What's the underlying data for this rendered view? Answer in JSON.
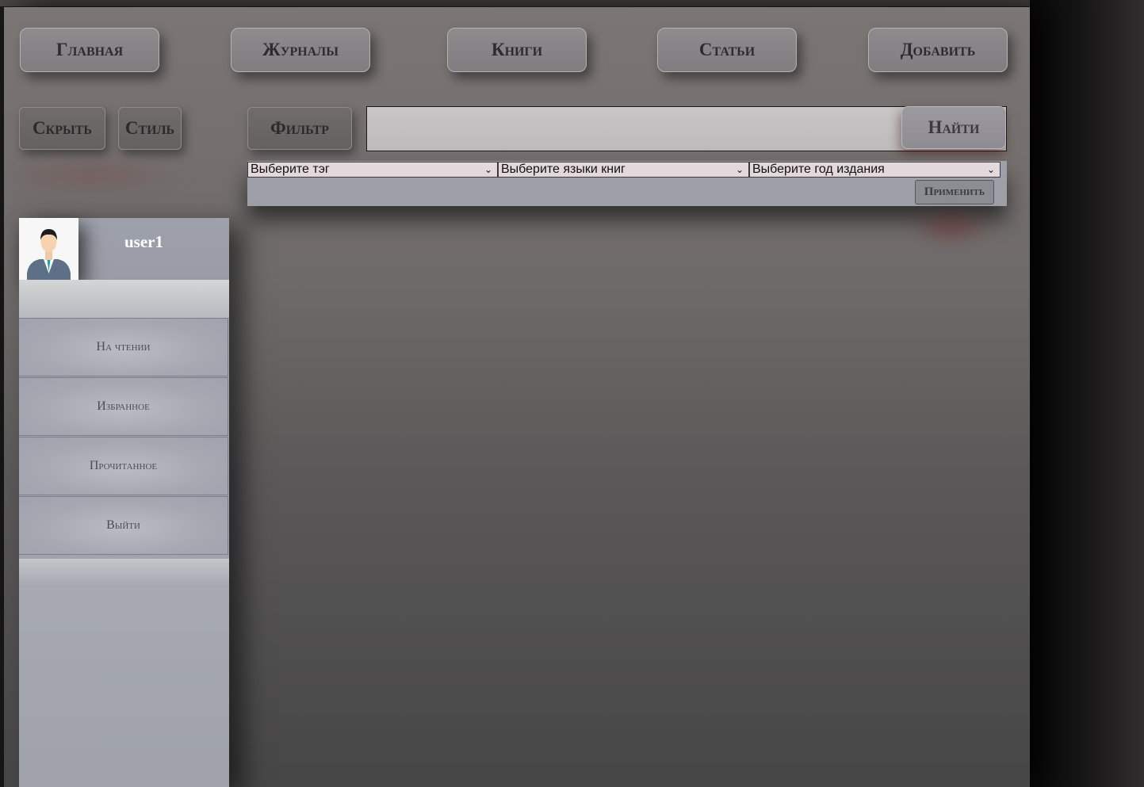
{
  "nav": {
    "items": [
      {
        "label": "Главная"
      },
      {
        "label": "Журналы"
      },
      {
        "label": "Книги"
      },
      {
        "label": "Статьи"
      },
      {
        "label": "Добавить"
      }
    ]
  },
  "toolbar": {
    "hide_label": "Скрыть",
    "style_label": "Стиль",
    "filter_label": "Фильтр",
    "search_value": "",
    "search_placeholder": "",
    "find_label": "Найти"
  },
  "filters": {
    "tag_select": "Выберите тэг",
    "language_select": "Выберите языки книг",
    "year_select": "Выберите год издания",
    "apply_label": "Применить"
  },
  "sidebar": {
    "username": "user1",
    "avatar_icon": "user-avatar-icon",
    "items": [
      {
        "label": "На чтении"
      },
      {
        "label": "Избранное"
      },
      {
        "label": "Прочитанное"
      },
      {
        "label": "Выйти"
      }
    ]
  },
  "colors": {
    "panel": "#9ea0a8",
    "select_bg": "#e3d9dc",
    "button_bg": "#8d8b8c",
    "username_text": "#ffffff"
  }
}
